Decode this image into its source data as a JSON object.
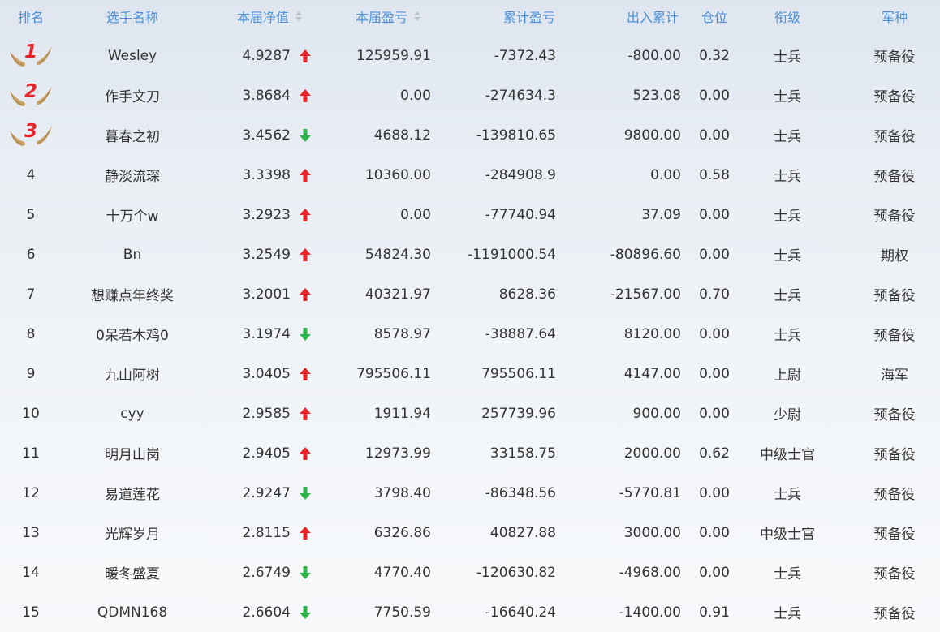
{
  "columns": {
    "rank": "排名",
    "name": "选手名称",
    "nav": "本届净值",
    "pnl": "本届盈亏",
    "cum_pnl": "累计盈亏",
    "flow": "出入累计",
    "position": "仓位",
    "grade": "衔级",
    "branch": "军种"
  },
  "colors": {
    "header_text": "#4a90d9",
    "up_arrow": "#e8242a",
    "down_arrow": "#2db34a",
    "medal_number": "#e8242a"
  },
  "rows": [
    {
      "rank": "1",
      "medal": true,
      "name": "Wesley",
      "nav": "4.9287",
      "trend": "up",
      "pnl": "125959.91",
      "cum_pnl": "-7372.43",
      "flow": "-800.00",
      "position": "0.32",
      "grade": "士兵",
      "branch": "预备役"
    },
    {
      "rank": "2",
      "medal": true,
      "name": "作手文刀",
      "nav": "3.8684",
      "trend": "up",
      "pnl": "0.00",
      "cum_pnl": "-274634.3",
      "flow": "523.08",
      "position": "0.00",
      "grade": "士兵",
      "branch": "预备役"
    },
    {
      "rank": "3",
      "medal": true,
      "name": "暮春之初",
      "nav": "3.4562",
      "trend": "down",
      "pnl": "4688.12",
      "cum_pnl": "-139810.65",
      "flow": "9800.00",
      "position": "0.00",
      "grade": "士兵",
      "branch": "预备役"
    },
    {
      "rank": "4",
      "name": "静淡流琛",
      "nav": "3.3398",
      "trend": "up",
      "pnl": "10360.00",
      "cum_pnl": "-284908.9",
      "flow": "0.00",
      "position": "0.58",
      "grade": "士兵",
      "branch": "预备役"
    },
    {
      "rank": "5",
      "name": "十万个w",
      "nav": "3.2923",
      "trend": "up",
      "pnl": "0.00",
      "cum_pnl": "-77740.94",
      "flow": "37.09",
      "position": "0.00",
      "grade": "士兵",
      "branch": "预备役"
    },
    {
      "rank": "6",
      "name": "Bn",
      "nav": "3.2549",
      "trend": "up",
      "pnl": "54824.30",
      "cum_pnl": "-1191000.54",
      "flow": "-80896.60",
      "position": "0.00",
      "grade": "士兵",
      "branch": "期权"
    },
    {
      "rank": "7",
      "name": "想赚点年终奖",
      "nav": "3.2001",
      "trend": "up",
      "pnl": "40321.97",
      "cum_pnl": "8628.36",
      "flow": "-21567.00",
      "position": "0.70",
      "grade": "士兵",
      "branch": "预备役"
    },
    {
      "rank": "8",
      "name": "0呆若木鸡0",
      "nav": "3.1974",
      "trend": "down",
      "pnl": "8578.97",
      "cum_pnl": "-38887.64",
      "flow": "8120.00",
      "position": "0.00",
      "grade": "士兵",
      "branch": "预备役"
    },
    {
      "rank": "9",
      "name": "九山阿树",
      "nav": "3.0405",
      "trend": "up",
      "pnl": "795506.11",
      "cum_pnl": "795506.11",
      "flow": "4147.00",
      "position": "0.00",
      "grade": "上尉",
      "branch": "海军"
    },
    {
      "rank": "10",
      "name": "cyy",
      "nav": "2.9585",
      "trend": "up",
      "pnl": "1911.94",
      "cum_pnl": "257739.96",
      "flow": "900.00",
      "position": "0.00",
      "grade": "少尉",
      "branch": "预备役"
    },
    {
      "rank": "11",
      "name": "明月山岗",
      "nav": "2.9405",
      "trend": "up",
      "pnl": "12973.99",
      "cum_pnl": "33158.75",
      "flow": "2000.00",
      "position": "0.62",
      "grade": "中级士官",
      "branch": "预备役"
    },
    {
      "rank": "12",
      "name": "易道莲花",
      "nav": "2.9247",
      "trend": "down",
      "pnl": "3798.40",
      "cum_pnl": "-86348.56",
      "flow": "-5770.81",
      "position": "0.00",
      "grade": "士兵",
      "branch": "预备役"
    },
    {
      "rank": "13",
      "name": "光辉岁月",
      "nav": "2.8115",
      "trend": "up",
      "pnl": "6326.86",
      "cum_pnl": "40827.88",
      "flow": "3000.00",
      "position": "0.00",
      "grade": "中级士官",
      "branch": "预备役"
    },
    {
      "rank": "14",
      "name": "暖冬盛夏",
      "nav": "2.6749",
      "trend": "down",
      "pnl": "4770.40",
      "cum_pnl": "-120630.82",
      "flow": "-4968.00",
      "position": "0.00",
      "grade": "士兵",
      "branch": "预备役"
    },
    {
      "rank": "15",
      "name": "QDMN168",
      "nav": "2.6604",
      "trend": "down",
      "pnl": "7750.59",
      "cum_pnl": "-16640.24",
      "flow": "-1400.00",
      "position": "0.91",
      "grade": "士兵",
      "branch": "预备役"
    }
  ]
}
